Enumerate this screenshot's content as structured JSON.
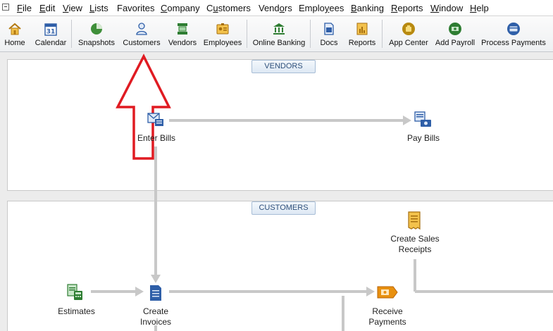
{
  "menu": {
    "items": [
      {
        "key": "F",
        "rest": "ile"
      },
      {
        "key": "E",
        "rest": "dit"
      },
      {
        "key": "V",
        "rest": "iew"
      },
      {
        "key": "L",
        "rest": "ists"
      },
      {
        "key": "",
        "rest": "Favorites"
      },
      {
        "key": "C",
        "rest": "ompany"
      },
      {
        "key": "",
        "pre": "C",
        "key2": "u",
        "rest": "stomers"
      },
      {
        "key": "",
        "pre": "Vend",
        "key2": "o",
        "rest": "rs"
      },
      {
        "key": "",
        "pre": "Emplo",
        "key2": "y",
        "rest": "ees"
      },
      {
        "key": "B",
        "rest": "anking"
      },
      {
        "key": "R",
        "rest": "eports"
      },
      {
        "key": "W",
        "rest": "indow"
      },
      {
        "key": "H",
        "rest": "elp"
      }
    ]
  },
  "toolbar": {
    "home": "Home",
    "calendar": "Calendar",
    "calendar_day": "31",
    "snapshots": "Snapshots",
    "customers": "Customers",
    "vendors": "Vendors",
    "employees": "Employees",
    "online_banking": "Online Banking",
    "docs": "Docs",
    "reports": "Reports",
    "app_center": "App Center",
    "add_payroll": "Add Payroll",
    "process_payments": "Process Payments"
  },
  "vendors_panel": {
    "tab": "VENDORS",
    "enter_bills": "Enter Bills",
    "pay_bills": "Pay Bills"
  },
  "customers_panel": {
    "tab": "CUSTOMERS",
    "create_sales_receipts_1": "Create Sales",
    "create_sales_receipts_2": "Receipts",
    "estimates": "Estimates",
    "create_invoices_1": "Create",
    "create_invoices_2": "Invoices",
    "receive_payments_1": "Receive",
    "receive_payments_2": "Payments"
  },
  "colors": {
    "annotation_arrow": "#e01b22",
    "flow_line": "#c8c8c8",
    "tab_text": "#2e4f7a"
  }
}
